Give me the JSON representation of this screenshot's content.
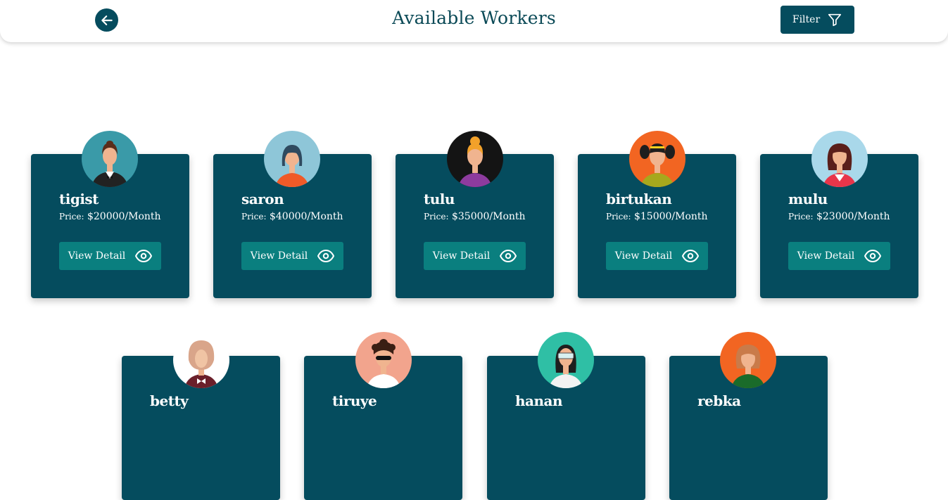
{
  "header": {
    "title": "Available Workers",
    "filter_label": "Filter"
  },
  "price_label": "Price:",
  "view_detail_label": "View Detail",
  "workers": [
    {
      "name": "tigist",
      "price": "$20000/Month"
    },
    {
      "name": "saron",
      "price": "$40000/Month"
    },
    {
      "name": "tulu",
      "price": "$35000/Month"
    },
    {
      "name": "birtukan",
      "price": "$15000/Month"
    },
    {
      "name": "mulu",
      "price": "$23000/Month"
    },
    {
      "name": "betty",
      "price": ""
    },
    {
      "name": "tiruye",
      "price": ""
    },
    {
      "name": "hanan",
      "price": ""
    },
    {
      "name": "rebka",
      "price": ""
    }
  ],
  "colors": {
    "primary": "#054c5e",
    "button": "#0a7f7f",
    "title": "#0b4a57"
  }
}
